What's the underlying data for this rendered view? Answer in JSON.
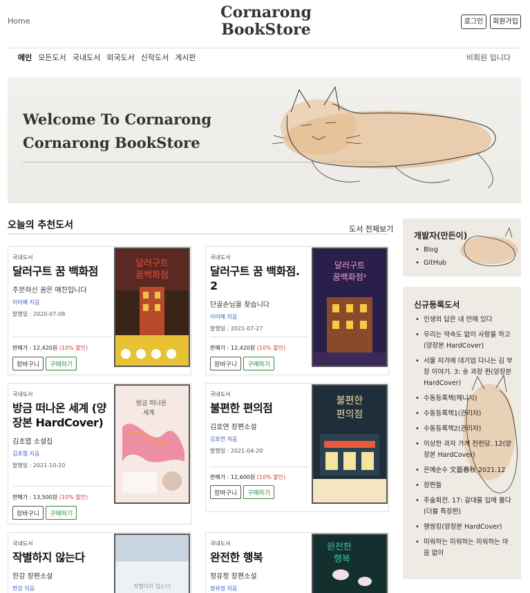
{
  "header": {
    "home": "Home",
    "logo_line1": "Cornarong",
    "logo_line2": "BookStore",
    "login": "로그인",
    "signup": "회원가입"
  },
  "nav": {
    "items": [
      "메인",
      "모든도서",
      "국내도서",
      "외국도서",
      "신작도서",
      "게시판"
    ],
    "guest": "비회원 입니다"
  },
  "hero": {
    "line1": "Welcome To Cornarong",
    "line2": "Cornarong BookStore"
  },
  "recommend": {
    "title": "오늘의 추천도서",
    "see_all": "도서 전체보기",
    "cart_label": "장바구니",
    "buy_label": "구매하기",
    "price_prefix": "판매가 : ",
    "books": [
      {
        "category": "국내도서",
        "title": "달러구트 꿈 백화점",
        "subtitle": "주문하신 꿈은 매진입니다",
        "author": "이미예 지음",
        "date": "발행일 : 2020-07-08",
        "price": "12,420원",
        "discount": "(10% 할인)"
      },
      {
        "category": "국내도서",
        "title": "달러구트 꿈 백화점. 2",
        "subtitle": "단골손님을 찾습니다",
        "author": "이미예 지음",
        "date": "발행일 : 2021-07-27",
        "price": "12,420원",
        "discount": "(10% 할인)"
      },
      {
        "category": "국내도서",
        "title": "방금 떠나온 세계 (양장본 HardCover)",
        "subtitle": "김초엽 소설집",
        "author": "김초엽 지음",
        "date": "발행일 : 2021-10-20",
        "price": "13,500원",
        "discount": "(10% 할인)"
      },
      {
        "category": "국내도서",
        "title": "불편한 편의점",
        "subtitle": "김호연 장편소설",
        "author": "김호연 지음",
        "date": "발행일 : 2021-04-20",
        "price": "12,600원",
        "discount": "(10% 할인)"
      },
      {
        "category": "국내도서",
        "title": "작별하지 않는다",
        "subtitle": "한강 장편소설",
        "author": "한강 지음"
      },
      {
        "category": "국내도서",
        "title": "완전한 행복",
        "subtitle": "정유정 장편소설",
        "author": "정유정 지음"
      }
    ]
  },
  "sidebar": {
    "dev_title": "개발자(만든이)",
    "dev_links": [
      "Blog",
      "GitHub"
    ],
    "new_title": "신규등록도서",
    "new_books": [
      "인생의 답은 내 안에 있다",
      "우리는 약속도 없이 사랑을 하고(양장본 HardCover)",
      "서울 자가에 대기업 다니는 김 부장 이야기. 3: 송 과장 편(양장본 HardCover)",
      "수동등록책(헤니지)",
      "수동등록책1(관리자)",
      "수동등록책2(관리자)",
      "이상한 과자 가게 전천당. 12(양장본 HardCover)",
      "은예순수 文藝春秋 2021.12",
      "장편들",
      "주술회전. 17: 갈대를 입에 물다(더블 특장판)",
      "웬씽킹(양장본 HardCover)",
      "미워하는 미워하는 미워하는 마음 없이"
    ]
  },
  "colors": {
    "link_blue": "#3a55c9",
    "discount_red": "#dd3333",
    "buy_green": "#2a8a3a",
    "hero_bg": "#eeece7"
  }
}
